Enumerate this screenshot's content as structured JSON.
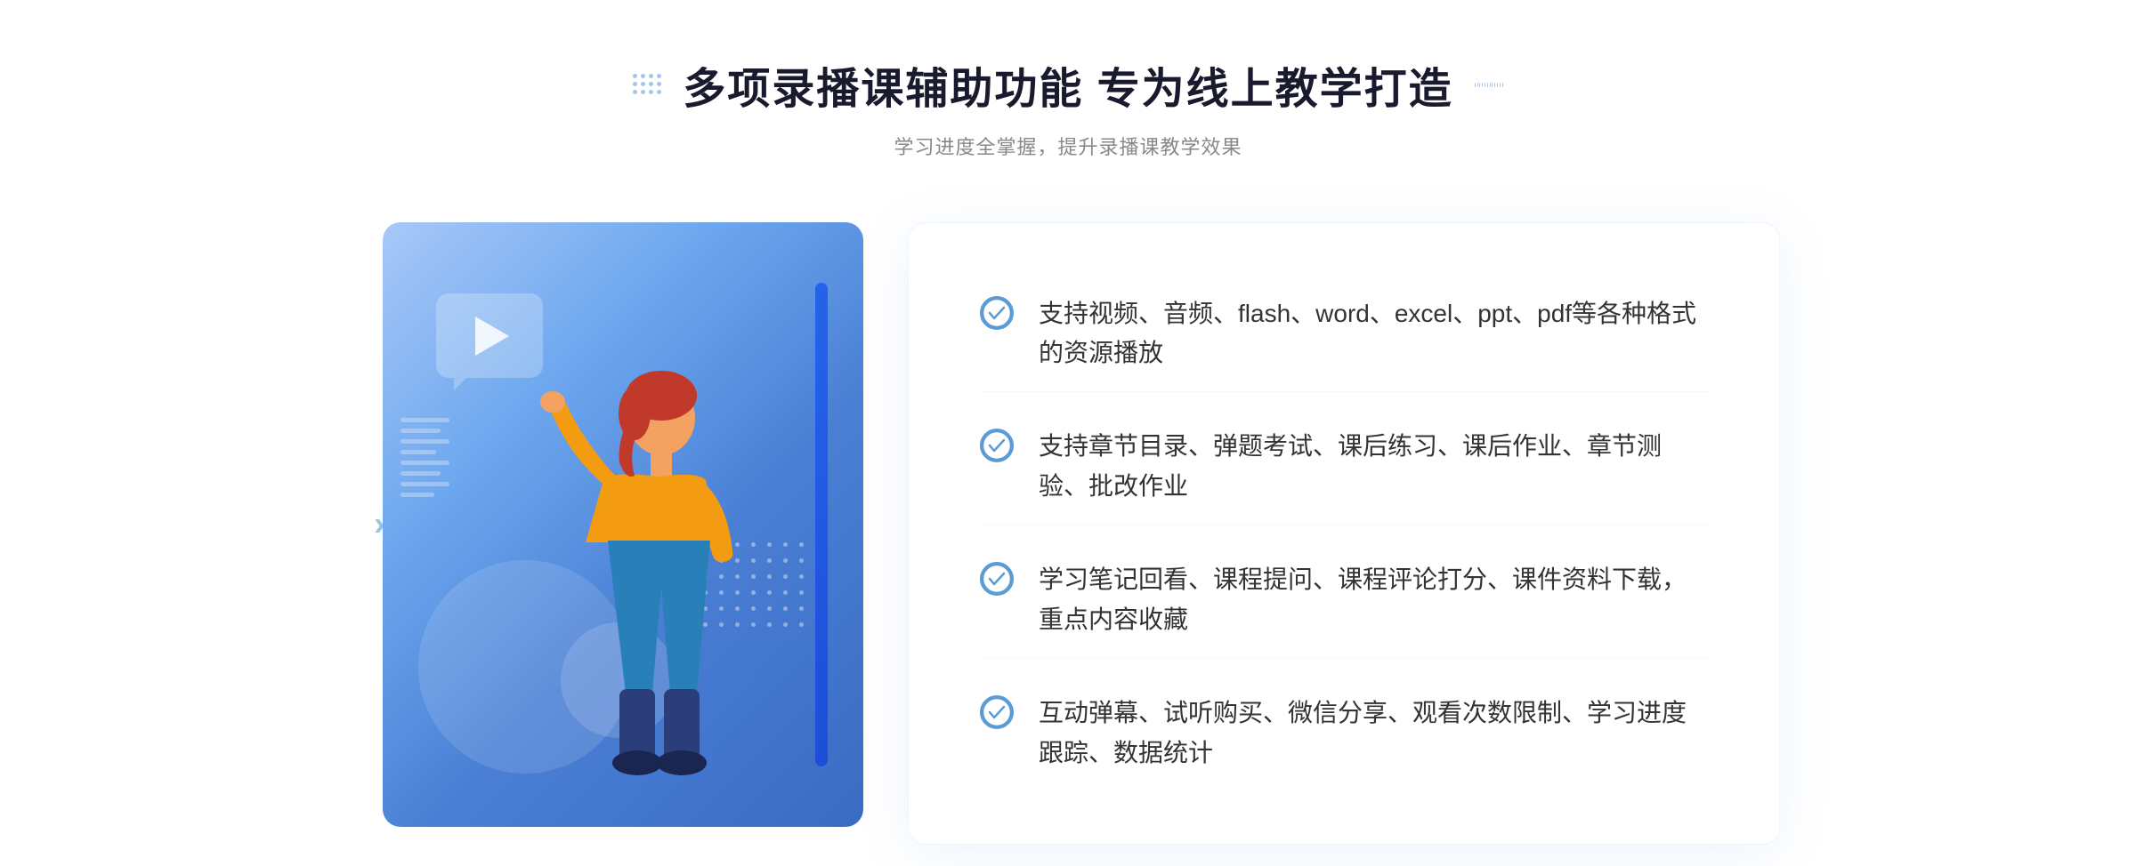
{
  "header": {
    "title": "多项录播课辅助功能 专为线上教学打造",
    "subtitle": "学习进度全掌握，提升录播课教学效果"
  },
  "features": [
    {
      "id": "feature-1",
      "text": "支持视频、音频、flash、word、excel、ppt、pdf等各种格式的资源播放"
    },
    {
      "id": "feature-2",
      "text": "支持章节目录、弹题考试、课后练习、课后作业、章节测验、批改作业"
    },
    {
      "id": "feature-3",
      "text": "学习笔记回看、课程提问、课程评论打分、课件资料下载，重点内容收藏"
    },
    {
      "id": "feature-4",
      "text": "互动弹幕、试听购买、微信分享、观看次数限制、学习进度跟踪、数据统计"
    }
  ],
  "decorative": {
    "arrow_left": "»",
    "arrow_right": "»"
  }
}
